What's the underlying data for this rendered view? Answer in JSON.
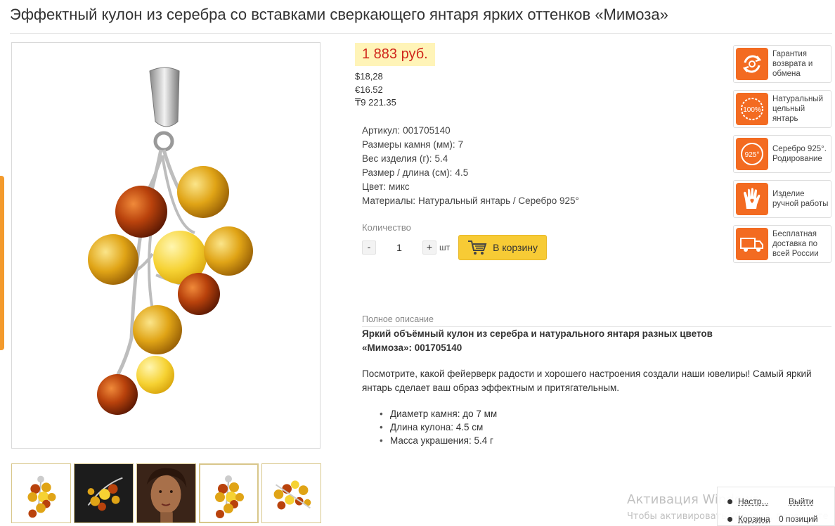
{
  "page": {
    "title": "Эффектный кулон из серебра со вставками сверкающего янтаря ярких оттенков «Мимоза»"
  },
  "gallery": {
    "thumbnails": [
      "pendant-front",
      "pendant-dark-background",
      "model-portrait",
      "pendant-front-selected",
      "scattered-beads"
    ]
  },
  "price": {
    "main": "1 883 руб.",
    "usd": "$18,28",
    "eur": "€16.52",
    "kzt": "₸9 221.35"
  },
  "specs": [
    {
      "label": "Артикул:",
      "value": "001705140"
    },
    {
      "label": "Размеры камня (мм):",
      "value": "7"
    },
    {
      "label": "Вес изделия (г):",
      "value": "5.4"
    },
    {
      "label": "Размер / длина (см):",
      "value": "4.5"
    },
    {
      "label": "Цвет:",
      "value": "микс"
    },
    {
      "label": "Материалы:",
      "value": "Натуральный янтарь / Серебро 925°"
    }
  ],
  "order": {
    "qty_label": "Количество",
    "minus": "-",
    "plus": "+",
    "qty_value": "1",
    "unit": "шт",
    "cart_button": "В корзину"
  },
  "description": {
    "label": "Полное описание",
    "title": "Яркий объёмный кулон из серебра и натурального янтаря разных цветов «Мимоза»: 001705140",
    "text": "Посмотрите, какой фейерверк радости и хорошего настроения создали наши ювелиры! Самый яркий янтарь сделает ваш образ эффектным и притягательным.",
    "bullets": [
      "Диаметр камня: до 7 мм",
      "Длина кулона: 4.5 см",
      "Масса украшения: 5.4 г"
    ]
  },
  "badges": [
    {
      "icon": "refresh-icon",
      "text": "Гарантия возврата и обмена"
    },
    {
      "icon": "100-percent-icon",
      "text": "Натуральный цельный янтарь"
    },
    {
      "icon": "silver-925-icon",
      "text": "Серебро 925°. Родирование"
    },
    {
      "icon": "hand-heart-icon",
      "text": "Изделие ручной работы"
    },
    {
      "icon": "truck-icon",
      "text": "Бесплатная доставка по всей России"
    }
  ],
  "badge_icon_text": {
    "percent": "100%",
    "silver": "925°"
  },
  "watermark": {
    "line1": "Активация Windows",
    "line2": "Чтобы активировать Windows, перейдите"
  },
  "popup": {
    "settings": "Настр...",
    "exit": "Выйти",
    "cart": "Корзина",
    "cart_count": "0 позиций"
  },
  "colors": {
    "accent_orange": "#f36b21",
    "price_red": "#d0261c",
    "price_bg": "#fff4b8",
    "cart_button": "#f7cb35"
  }
}
